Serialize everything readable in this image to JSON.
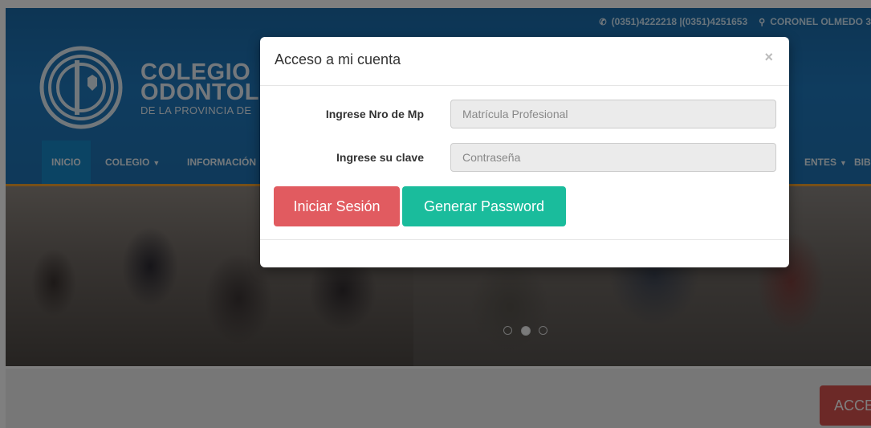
{
  "contact": {
    "phones": "(0351)4222218 |(0351)4251653",
    "address": "CORONEL OLMEDO 3"
  },
  "logo": {
    "line1": "COLEGIO",
    "line2": "ODONTOLÓ",
    "line3": "DE LA PROVINCIA DE"
  },
  "nav": {
    "items": [
      "INICIO",
      "COLEGIO",
      "INFORMACIÓN",
      "ENTES",
      "BIB"
    ],
    "active": "INICIO"
  },
  "carousel": {
    "active_slide": 2,
    "slide_count": 3
  },
  "access_button": "ACCE",
  "modal": {
    "title": "Acceso a mi cuenta",
    "close_symbol": "×",
    "mp_label": "Ingrese Nro de Mp",
    "mp_placeholder": "Matrícula Profesional",
    "mp_value": "",
    "password_label": "Ingrese su clave",
    "password_placeholder": "Contraseña",
    "password_value": "",
    "login_button": "Iniciar Sesión",
    "generate_button": "Generar Password"
  },
  "colors": {
    "header_blue": "#1e72b3",
    "active_nav": "#1688c9",
    "login_button": "#e15b60",
    "generate_button": "#1abc9c",
    "access_button": "#d9534f"
  }
}
